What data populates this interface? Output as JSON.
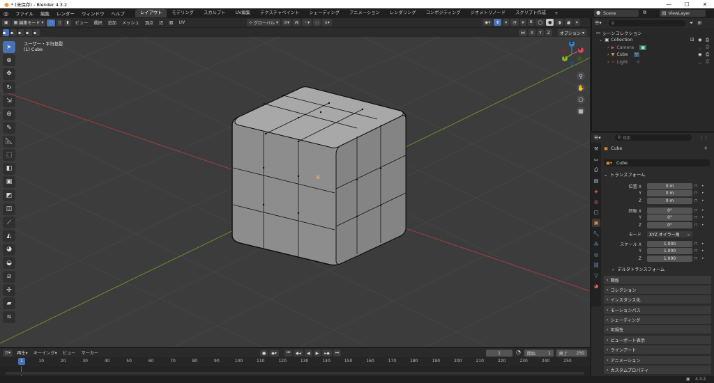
{
  "titlebar": {
    "title": "* (未保存) - Blender 4.3.2",
    "min": "—",
    "max": "☐",
    "close": "✕"
  },
  "menus": [
    "ファイル",
    "編集",
    "レンダー",
    "ウィンドウ",
    "ヘルプ"
  ],
  "workspaces": [
    "レイアウト",
    "モデリング",
    "スカルプト",
    "UV編集",
    "テクスチャペイント",
    "シェーディング",
    "アニメーション",
    "レンダリング",
    "コンポジティング",
    "ジオメトリノード",
    "スクリプト作成"
  ],
  "workspace_add": "+",
  "scene": {
    "label": "Scene",
    "viewlayer": "ViewLayer"
  },
  "vp_header": {
    "mode": "編集モード",
    "menus": [
      "ビュー",
      "選択",
      "追加",
      "メッシュ",
      "頂点",
      "辺",
      "面",
      "UV"
    ],
    "orientation": "グローバル"
  },
  "vp_header2": {
    "axes": [
      "X",
      "Y",
      "Z"
    ],
    "options": "オプション"
  },
  "viewport": {
    "view_name": "ユーザー・平行投影",
    "object_name": "(1) Cube"
  },
  "gizmo": {
    "x": "X",
    "y": "Y",
    "z": "Z"
  },
  "outliner": {
    "search_placeholder": "",
    "title": "シーンコレクション",
    "collection": "Collection",
    "items": [
      {
        "name": "Camera"
      },
      {
        "name": "Cube"
      },
      {
        "name": "Light"
      }
    ]
  },
  "props": {
    "search_placeholder": "検索",
    "object_name": "Cube",
    "mesh_name": "Cube",
    "transform_title": "トランスフォーム",
    "location_label": "位置 X",
    "loc": [
      "0 m",
      "0 m",
      "0 m"
    ],
    "rotation_label": "回転 X",
    "rot": [
      "0°",
      "0°",
      "0°"
    ],
    "mode_label": "モード",
    "mode_value": "XYZ オイラー角",
    "scale_label": "スケール X",
    "scale": [
      "1.000",
      "1.000",
      "1.000"
    ],
    "y": "Y",
    "z": "Z",
    "delta": "デルタトランスフォーム",
    "panels": [
      "関係",
      "コレクション",
      "インスタンス化",
      "モーションパス",
      "シェーディング",
      "可視性",
      "ビューポート表示",
      "ラインアート",
      "アニメーション",
      "カスタムプロパティ"
    ]
  },
  "timeline": {
    "menus": [
      "再生",
      "キーイング",
      "ビュー",
      "マーカー"
    ],
    "current_frame": "1",
    "start_label": "開始",
    "start": "1",
    "end_label": "終了",
    "end": "250",
    "ticks": [
      "1",
      "10",
      "20",
      "30",
      "40",
      "50",
      "60",
      "70",
      "80",
      "90",
      "100",
      "110",
      "120",
      "130",
      "140",
      "150",
      "160",
      "170",
      "180",
      "190",
      "200",
      "210",
      "220",
      "230",
      "240",
      "250"
    ]
  },
  "status": {
    "version": "4.3.2"
  }
}
